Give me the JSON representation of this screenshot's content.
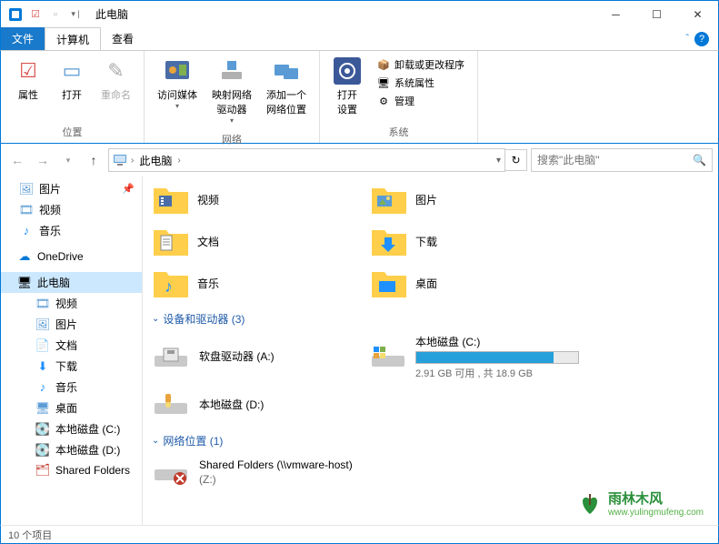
{
  "title": "此电脑",
  "tabs": {
    "file": "文件",
    "computer": "计算机",
    "view": "查看"
  },
  "ribbon": {
    "location": {
      "label": "位置",
      "properties": "属性",
      "open": "打开",
      "rename": "重命名"
    },
    "network": {
      "label": "网络",
      "media": "访问媒体",
      "mapdrive": "映射网络\n驱动器",
      "addloc": "添加一个\n网络位置"
    },
    "system": {
      "label": "系统",
      "opensettings": "打开\n设置",
      "uninstall": "卸载或更改程序",
      "sysprops": "系统属性",
      "manage": "管理"
    }
  },
  "address": {
    "pc": "此电脑"
  },
  "search": {
    "placeholder": "搜索\"此电脑\""
  },
  "nav": {
    "pictures": "图片",
    "videos": "视频",
    "music": "音乐",
    "onedrive": "OneDrive",
    "thispc": "此电脑",
    "pc_videos": "视频",
    "pc_pictures": "图片",
    "pc_documents": "文档",
    "pc_downloads": "下载",
    "pc_music": "音乐",
    "pc_desktop": "桌面",
    "pc_diskc": "本地磁盘 (C:)",
    "pc_diskd": "本地磁盘 (D:)",
    "pc_shared": "Shared Folders"
  },
  "folders": {
    "videos": "视频",
    "pictures": "图片",
    "documents": "文档",
    "downloads": "下载",
    "music": "音乐",
    "desktop": "桌面"
  },
  "sections": {
    "devices": "设备和驱动器 (3)",
    "network": "网络位置 (1)"
  },
  "drives": {
    "floppy": "软盘驱动器 (A:)",
    "c": {
      "name": "本地磁盘 (C:)",
      "sub": "2.91 GB 可用 , 共 18.9 GB",
      "pct": 85
    },
    "d": "本地磁盘 (D:)",
    "shared": {
      "name": "Shared Folders (\\\\vmware-host)",
      "sub": "(Z:)"
    }
  },
  "status": "10 个项目",
  "watermark": {
    "name": "雨林木风",
    "url": "www.yulingmufeng.com"
  }
}
